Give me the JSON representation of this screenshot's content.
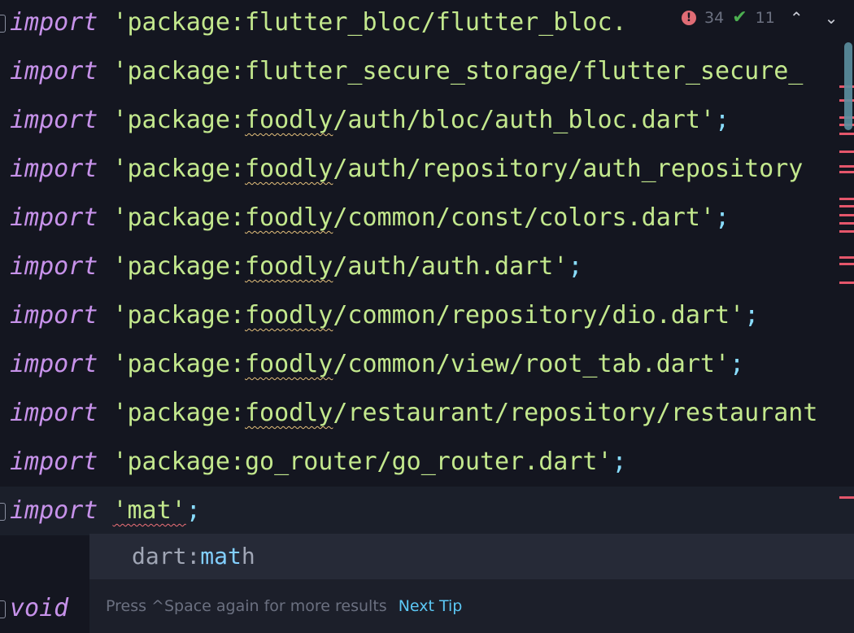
{
  "inspections": {
    "errors": "34",
    "warnings": "11"
  },
  "code": {
    "keyword_import": "import",
    "keyword_void": "void",
    "lines": [
      {
        "pre": "'package:",
        "flag": "",
        "rest": "flutter_bloc/flutter_bloc.",
        "end": ""
      },
      {
        "pre": "'package:",
        "flag": "",
        "rest": "flutter_secure_storage/flutter_secure_",
        "end": ""
      },
      {
        "pre": "'package:",
        "flag": "foodly",
        "rest": "/auth/bloc/auth_bloc.dart'",
        "end": ";"
      },
      {
        "pre": "'package:",
        "flag": "foodly",
        "rest": "/auth/repository/auth_repository",
        "end": ""
      },
      {
        "pre": "'package:",
        "flag": "foodly",
        "rest": "/common/const/colors.dart'",
        "end": ";"
      },
      {
        "pre": "'package:",
        "flag": "foodly",
        "rest": "/auth/auth.dart'",
        "end": ";"
      },
      {
        "pre": "'package:",
        "flag": "foodly",
        "rest": "/common/repository/dio.dart'",
        "end": ";"
      },
      {
        "pre": "'package:",
        "flag": "foodly",
        "rest": "/common/view/root_tab.dart'",
        "end": ";"
      },
      {
        "pre": "'package:",
        "flag": "foodly",
        "rest": "/restaurant/repository/restaurant",
        "end": ""
      },
      {
        "pre": "'package:",
        "flag": "",
        "rest": "go_router/go_router.dart'",
        "end": ";"
      }
    ],
    "current_string": "'mat'",
    "current_end": ";"
  },
  "completion": {
    "item_prefix": "dart:",
    "item_match": "mat",
    "item_suffix": "h",
    "hint": "Press ^Space again for more results",
    "next_tip": "Next Tip"
  },
  "colors": {
    "background": "#141620",
    "error": "#e5566b",
    "accent": "#5cc8f5"
  }
}
